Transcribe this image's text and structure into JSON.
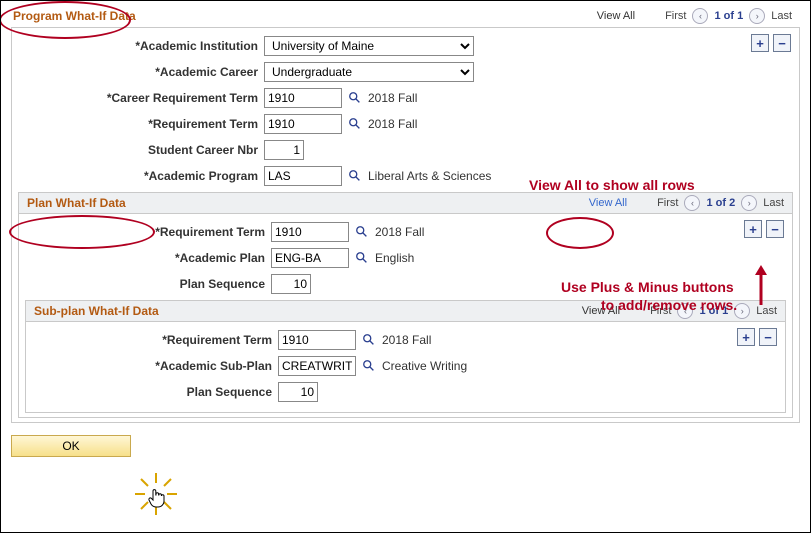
{
  "program": {
    "title": "Program What-If Data",
    "view_all": "View All",
    "first": "First",
    "counter": "1 of 1",
    "last": "Last",
    "fields": {
      "institution_label": "*Academic Institution",
      "institution_value": "University of Maine",
      "career_label": "*Academic Career",
      "career_value": "Undergraduate",
      "career_req_label": "*Career Requirement Term",
      "career_req_value": "1910",
      "career_req_desc": "2018 Fall",
      "req_term_label": "*Requirement Term",
      "req_term_value": "1910",
      "req_term_desc": "2018 Fall",
      "stu_nbr_label": "Student Career Nbr",
      "stu_nbr_value": "1",
      "acad_prog_label": "*Academic Program",
      "acad_prog_value": "LAS",
      "acad_prog_desc": "Liberal Arts & Sciences"
    }
  },
  "plan": {
    "title": "Plan What-If Data",
    "view_all": "View All",
    "first": "First",
    "counter": "1 of 2",
    "last": "Last",
    "fields": {
      "req_term_label": "*Requirement Term",
      "req_term_value": "1910",
      "req_term_desc": "2018 Fall",
      "acad_plan_label": "*Academic Plan",
      "acad_plan_value": "ENG-BA",
      "acad_plan_desc": "English",
      "seq_label": "Plan Sequence",
      "seq_value": "10"
    }
  },
  "subplan": {
    "title": "Sub-plan What-If Data",
    "view_all": "View All",
    "first": "First",
    "counter": "1 of 1",
    "last": "Last",
    "fields": {
      "req_term_label": "*Requirement Term",
      "req_term_value": "1910",
      "req_term_desc": "2018 Fall",
      "sub_plan_label": "*Academic Sub-Plan",
      "sub_plan_value": "CREATWRITI",
      "sub_plan_desc": "Creative Writing",
      "seq_label": "Plan Sequence",
      "seq_value": "10"
    }
  },
  "buttons": {
    "ok": "OK",
    "plus": "+",
    "minus": "−"
  },
  "annotations": {
    "view_all_note": "View All to show all rows",
    "plus_minus_note1": "Use Plus & Minus buttons",
    "plus_minus_note2": "to add/remove rows."
  },
  "icons": {
    "arrow_left": "‹",
    "arrow_right": "›"
  }
}
